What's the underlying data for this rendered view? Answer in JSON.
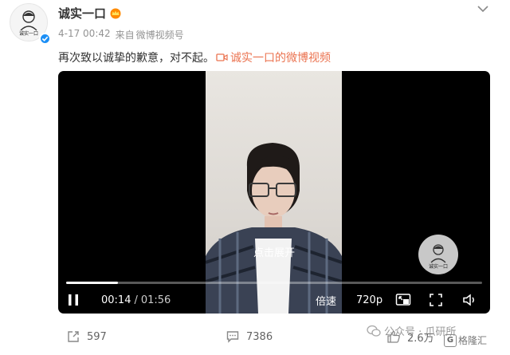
{
  "author": {
    "name": "诚实一口",
    "avatar_text": "诚实一口",
    "avatar_subtext": "HONESTBITE",
    "verified": true
  },
  "meta": {
    "date": "4-17 00:42",
    "source_prefix": "来自",
    "source": "微博视频号"
  },
  "post": {
    "text": "再次致以诚挚的歉意，对不起。",
    "video_link_label": "诚实一口的微博视频"
  },
  "player": {
    "overlay_label": "点击展开",
    "watermark_text": "诚实一口",
    "time_current": "00:14",
    "time_separator": "/",
    "time_total": "01:56",
    "progress_fraction": 0.125,
    "speed_label": "倍速",
    "quality_label": "720p"
  },
  "actions": {
    "repost_count": "597",
    "comment_count": "7386",
    "like_count": "2.6万"
  },
  "watermarks": {
    "wechat_text": "公众号 · 爪研所",
    "gelonghui_text": "格隆汇",
    "gelonghui_logo": "G"
  },
  "colors": {
    "link": "#eb7350",
    "verified": "#1c8ff5",
    "meta": "#939393"
  }
}
